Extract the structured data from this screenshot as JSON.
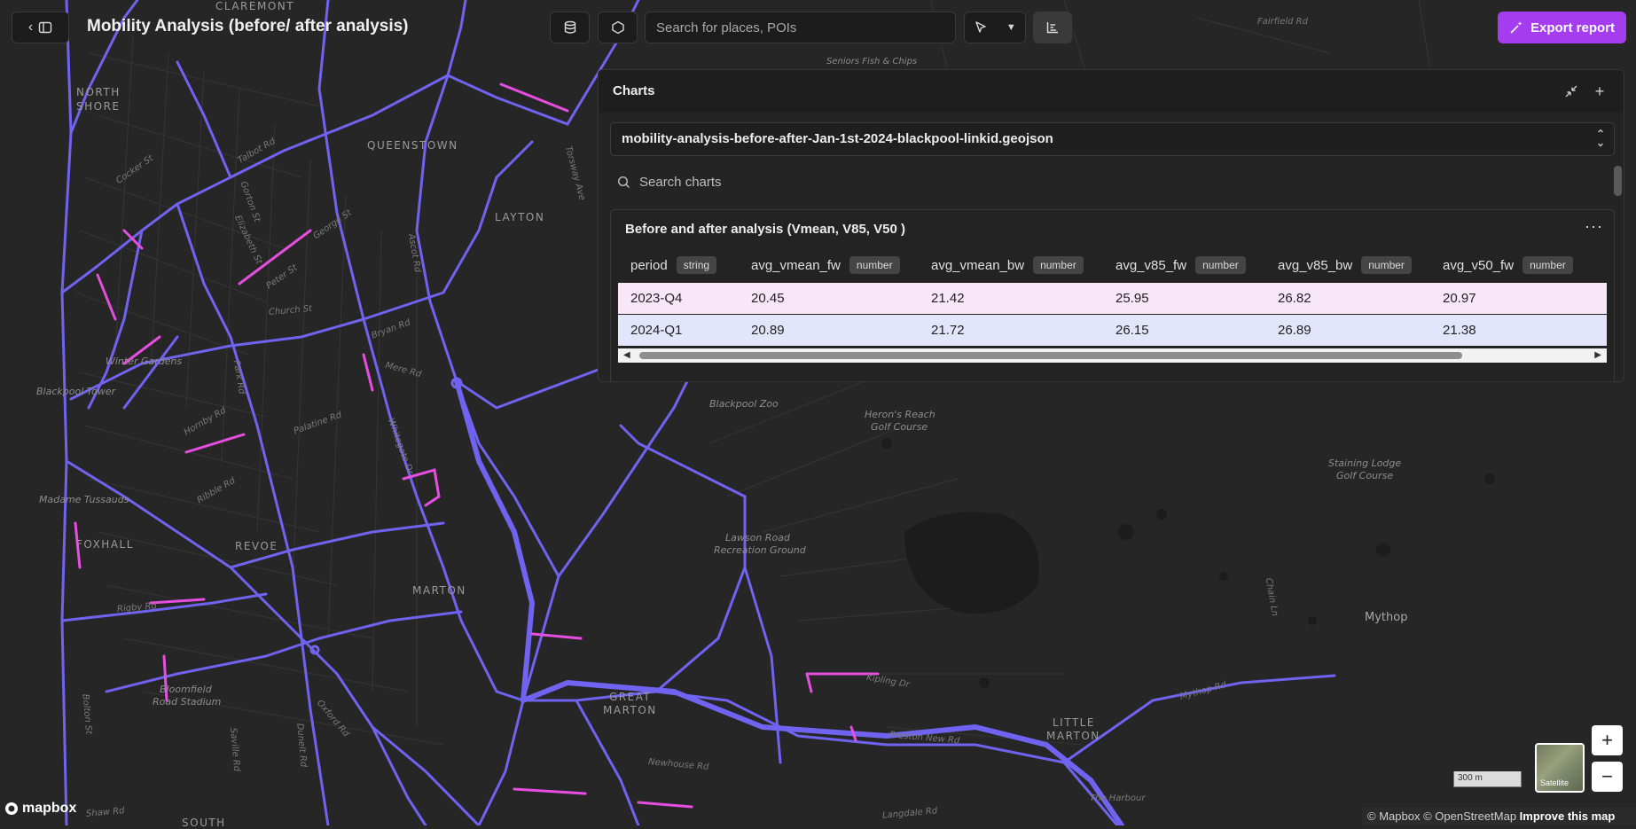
{
  "header": {
    "title": "Mobility Analysis (before/ after analysis)",
    "search_placeholder": "Search for places, POIs",
    "export_label": "Export report"
  },
  "charts_panel": {
    "title": "Charts",
    "dataset": "mobility-analysis-before-after-Jan-1st-2024-blackpool-linkid.geojson",
    "search_placeholder": "Search charts",
    "card": {
      "title": "Before and after analysis (Vmean, V85, V50 )",
      "columns": [
        {
          "name": "period",
          "type": "string"
        },
        {
          "name": "avg_vmean_fw",
          "type": "number"
        },
        {
          "name": "avg_vmean_bw",
          "type": "number"
        },
        {
          "name": "avg_v85_fw",
          "type": "number"
        },
        {
          "name": "avg_v85_bw",
          "type": "number"
        },
        {
          "name": "avg_v50_fw",
          "type": "number"
        }
      ],
      "rows": [
        [
          "2023-Q4",
          "20.45",
          "21.42",
          "25.95",
          "26.82",
          "20.97"
        ],
        [
          "2024-Q1",
          "20.89",
          "21.72",
          "26.15",
          "26.89",
          "21.38"
        ]
      ],
      "row_colors": [
        "#f8e6f9",
        "#e3e6fb"
      ]
    }
  },
  "map": {
    "labels": {
      "claremont": "CLAREMONT",
      "north_shore_1": "NORTH",
      "north_shore_2": "SHORE",
      "queenstown": "QUEENSTOWN",
      "layton": "LAYTON",
      "revoe": "REVOE",
      "marton": "MARTON",
      "great_marton_1": "GREAT",
      "great_marton_2": "MARTON",
      "little_marton_1": "LITTLE",
      "little_marton_2": "MARTON",
      "foxhall": "FOXHALL",
      "south": "SOUTH",
      "mythop": "Mythop",
      "blackpool_tower": "Blackpool Tower",
      "winter_gardens": "Winter Gardens",
      "madame_tussauds": "Madame Tussauds",
      "blackpool_zoo": "Blackpool Zoo",
      "herons_reach_1": "Heron's Reach",
      "herons_reach_2": "Golf Course",
      "staining_lodge_1": "Staining Lodge",
      "staining_lodge_2": "Golf Course",
      "lawson_road_1": "Lawson Road",
      "lawson_road_2": "Recreation Ground",
      "bloomfield_1": "Bloomfield",
      "bloomfield_2": "Road Stadium",
      "seniors": "Seniors Fish & Chips",
      "fairfield_rd": "Fairfield Rd",
      "cocker_st": "Cocker St",
      "talbot_rd": "Talbot Rd",
      "gorton_st": "Gorton St",
      "elizabeth_st": "Elizabeth St",
      "george_st": "George St",
      "peter_st": "Peter St",
      "church_st": "Church St",
      "ascot_rd": "Ascot Rd",
      "torsway_ave": "Torsway Ave",
      "bryan_rd": "Bryan Rd",
      "mere_rd": "Mere Rd",
      "palatine_rd": "Palatine Rd",
      "hornby_rd": "Hornby Rd",
      "ribble_rd": "Ribble Rd",
      "park_rd": "Park Rd",
      "rigby_rd": "Rigby Rd",
      "whitegate_dr": "Whitegate Dr",
      "newhouse_rd": "Newhouse Rd",
      "mythop_rd": "Mythop Rd",
      "preston_new_rd": "Preston New Rd",
      "kipling_dr": "Kipling Dr",
      "chain_ln": "Chain Ln",
      "langdale_rd": "Langdale Rd",
      "shaw_rd": "Shaw Rd",
      "bolton_st": "Bolton St",
      "saville_rd": "Saville Rd",
      "dunelt_rd": "Dunelt Rd",
      "oxford_rd": "Oxford Rd",
      "the_harbour": "The Harbour"
    },
    "scale_label": "300 m",
    "satellite_label": "Satellite",
    "attribution_mapbox": "© Mapbox",
    "attribution_osm": "© OpenStreetMap",
    "attribution_improve": "Improve this map",
    "brand": "mapbox",
    "colors": {
      "road": "#6f63f0",
      "highlight": "#e64ee0",
      "background": "#262626"
    }
  }
}
